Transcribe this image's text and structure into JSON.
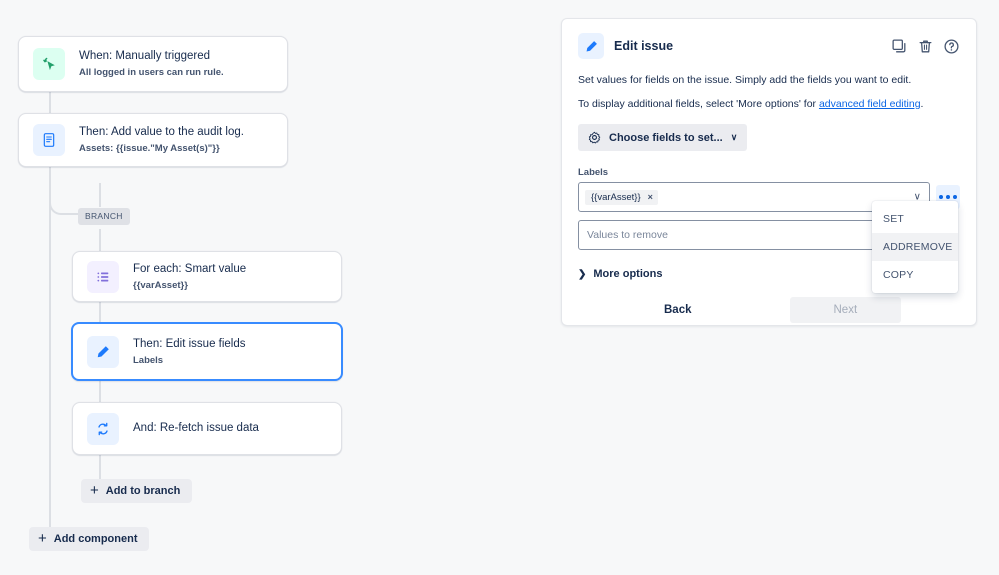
{
  "canvas": {
    "nodes": [
      {
        "title": "When: Manually triggered",
        "subtitle": "All logged in users can run rule.",
        "icon": "cursor-click-icon",
        "selected": false
      },
      {
        "title": "Then: Add value to the audit log.",
        "subtitle": "Assets: {{issue.\"My Asset(s)\"}}",
        "icon": "document-icon",
        "selected": false
      },
      {
        "title": "For each: Smart value",
        "subtitle": "{{varAsset}}",
        "icon": "list-icon",
        "selected": false
      },
      {
        "title": "Then: Edit issue fields",
        "subtitle": "Labels",
        "icon": "pencil-icon",
        "selected": true
      },
      {
        "title": "And: Re-fetch issue data",
        "subtitle": "",
        "icon": "refresh-icon",
        "selected": false
      }
    ],
    "branch_pill": "BRANCH",
    "add_to_branch": "Add to branch",
    "add_component": "Add component",
    "plus": "+"
  },
  "panel": {
    "title": "Edit issue",
    "icon": "pencil-icon",
    "actions": [
      {
        "name": "duplicate-icon",
        "label": "Duplicate"
      },
      {
        "name": "trash-icon",
        "label": "Delete"
      },
      {
        "name": "help-icon",
        "label": "Help"
      }
    ],
    "description_1": "Set values for fields on the issue. Simply add the fields you want to edit.",
    "description_2_pre": "To display additional fields, select 'More options' for ",
    "description_2_link": "advanced field editing",
    "description_2_post": ".",
    "choose_fields_label": "Choose fields to set...",
    "choose_fields_caret": "∨",
    "field": {
      "label": "Labels",
      "chip_value": "{{varAsset}}",
      "chip_remove": "×",
      "select_caret": "∨",
      "more_button": "more-options-button"
    },
    "remove_input_placeholder": "Values to remove",
    "more_options_label": "More options",
    "more_options_chevron": "❯",
    "back_label": "Back",
    "next_label": "Next"
  },
  "menu": {
    "items": [
      {
        "label": "SET",
        "hovered": false
      },
      {
        "label": "ADDREMOVE",
        "hovered": true
      },
      {
        "label": "COPY",
        "hovered": false
      }
    ]
  },
  "colors": {
    "background": "#f7f8f9",
    "accent_blue": "#0c66e4",
    "selected_border": "#388bff",
    "connector": "#dcdfe4",
    "text_primary": "#172b4d",
    "text_subtle": "#44546f"
  }
}
